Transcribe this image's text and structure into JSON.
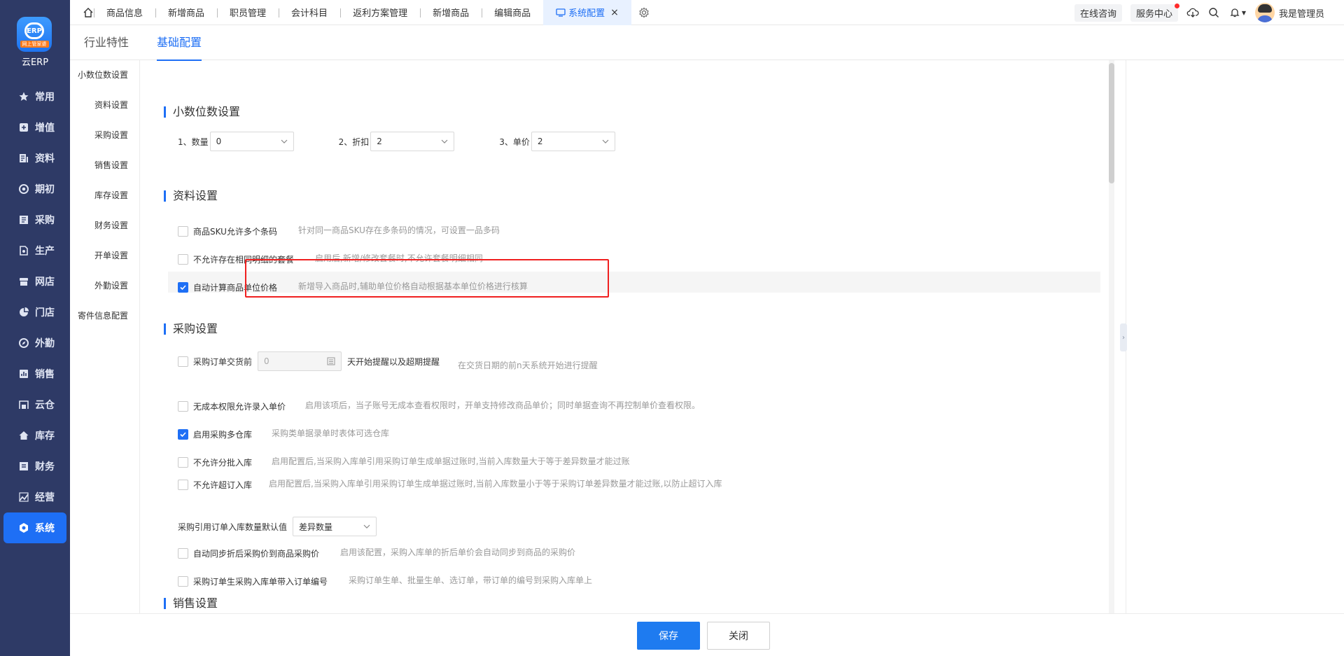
{
  "app": {
    "logo_badge_text": "ERP",
    "logo_ribbon": "网上管家婆",
    "logo_text": "云ERP"
  },
  "sidebar": {
    "items": [
      {
        "label": "常用",
        "icon": "star-icon"
      },
      {
        "label": "增值",
        "icon": "plus-square-icon"
      },
      {
        "label": "资料",
        "icon": "document-icon"
      },
      {
        "label": "期初",
        "icon": "target-icon"
      },
      {
        "label": "采购",
        "icon": "purchase-icon"
      },
      {
        "label": "生产",
        "icon": "production-icon"
      },
      {
        "label": "网店",
        "icon": "shop-icon"
      },
      {
        "label": "门店",
        "icon": "pie-icon"
      },
      {
        "label": "外勤",
        "icon": "compass-icon"
      },
      {
        "label": "销售",
        "icon": "chart-icon"
      },
      {
        "label": "云仓",
        "icon": "warehouse-icon"
      },
      {
        "label": "库存",
        "icon": "home-icon"
      },
      {
        "label": "财务",
        "icon": "finance-icon"
      },
      {
        "label": "经营",
        "icon": "business-icon"
      },
      {
        "label": "系统",
        "icon": "system-icon"
      }
    ],
    "active_index": 14
  },
  "topbar": {
    "tabs": [
      "商品信息",
      "新增商品",
      "职员管理",
      "会计科目",
      "返利方案管理",
      "新增商品",
      "编辑商品"
    ],
    "active_tab": "系统配置",
    "online_consult": "在线咨询",
    "service_center": "服务中心",
    "user_name": "我是管理员"
  },
  "subtabs": [
    "行业特性",
    "基础配置"
  ],
  "leftnav": [
    "小数位数设置",
    "资料设置",
    "采购设置",
    "销售设置",
    "库存设置",
    "财务设置",
    "开单设置",
    "外勤设置",
    "寄件信息配置"
  ],
  "decimal": {
    "title": "小数位数设置",
    "fields": [
      {
        "label": "1、数量",
        "value": "0"
      },
      {
        "label": "2、折扣",
        "value": "2"
      },
      {
        "label": "3、单价",
        "value": "2"
      }
    ]
  },
  "material": {
    "title": "资料设置",
    "options": [
      {
        "label": "商品SKU允许多个条码",
        "hint": "针对同一商品SKU存在多条码的情况，可设置一品多码",
        "checked": false
      },
      {
        "label": "不允许存在相同明细的套餐",
        "hint": "启用后,新增/修改套餐时,不允许套餐明细相同",
        "checked": false
      },
      {
        "label": "自动计算商品单位价格",
        "hint": "新增导入商品时,辅助单位价格自动根据基本单位价格进行核算",
        "checked": true
      }
    ]
  },
  "purchase": {
    "title": "采购设置",
    "delivery": {
      "label": "采购订单交货前",
      "value": "0",
      "suffix": "天开始提醒以及超期提醒",
      "hint": "在交货日期的前n天系统开始进行提醒",
      "checked": false
    },
    "options": [
      {
        "label": "无成本权限允许录入单价",
        "hint": "启用该项后，当子账号无成本查看权限时，开单支持修改商品单价；同时单据查询不再控制单价查看权限。",
        "checked": false
      },
      {
        "label": "启用采购多仓库",
        "hint": "采购类单据录单时表体可选仓库",
        "checked": true
      },
      {
        "label": "不允许分批入库",
        "hint": "启用配置后,当采购入库单引用采购订单生成单据过账时,当前入库数量大于等于差异数量才能过账",
        "checked": false
      },
      {
        "label": "不允许超订入库",
        "hint": "启用配置后,当采购入库单引用采购订单生成单据过账时,当前入库数量小于等于采购订单差异数量才能过账,以防止超订入库",
        "checked": false
      }
    ],
    "default_qty": {
      "label": "采购引用订单入库数量默认值",
      "value": "差异数量"
    },
    "options2": [
      {
        "label": "自动同步折后采购价到商品采购价",
        "hint": "启用该配置，采购入库单的折后单价会自动同步到商品的采购价",
        "checked": false
      },
      {
        "label": "采购订单生采购入库单带入订单编号",
        "hint": "采购订单生单、批量生单、选订单，带订单的编号到采购入库单上",
        "checked": false
      }
    ]
  },
  "sales": {
    "title": "销售设置"
  },
  "footer": {
    "save": "保存",
    "close": "关闭"
  },
  "colors": {
    "primary": "#1e6ff5",
    "sidebar": "#2e3a66",
    "highlight_border": "#f02020"
  }
}
